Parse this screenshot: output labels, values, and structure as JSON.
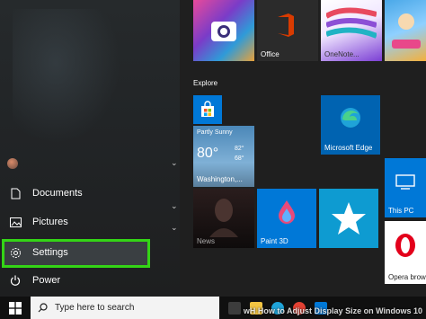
{
  "start_menu": {
    "items": [
      {
        "label": "Documents",
        "icon": "document-icon"
      },
      {
        "label": "Pictures",
        "icon": "pictures-icon"
      },
      {
        "label": "Settings",
        "icon": "gear-icon"
      },
      {
        "label": "Power",
        "icon": "power-icon"
      }
    ],
    "highlight_color": "#34d416"
  },
  "tiles": {
    "explore_label": "Explore",
    "office_label": "Office",
    "onenote_label": "OneNote...",
    "weather": {
      "condition": "Partly Sunny",
      "temp": "80°",
      "high": "82°",
      "low": "68°",
      "location": "Washington,..."
    },
    "edge_label": "Microsoft Edge",
    "news_label": "News",
    "paint3d_label": "Paint 3D",
    "thispc_label": "This PC",
    "opera_label": "Opera brow"
  },
  "taskbar": {
    "search_placeholder": "Type here to search"
  },
  "watermark": "wH How to Adjust Display Size on Windows 10"
}
